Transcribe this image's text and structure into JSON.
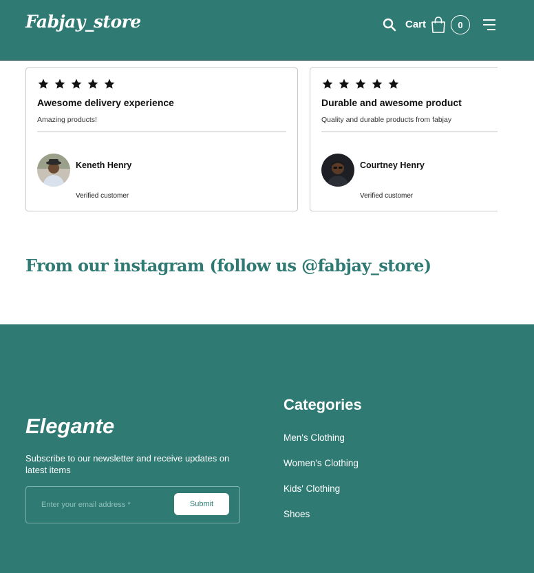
{
  "header": {
    "logo": "Fabjay_store",
    "cart_label": "Cart",
    "cart_count": "0"
  },
  "reviews": [
    {
      "rating": 5,
      "title": "Awesome delivery experience",
      "body": "Amazing products!",
      "name": "Keneth Henry",
      "status": "Verified customer"
    },
    {
      "rating": 5,
      "title": "Durable and awesome product",
      "body": "Quality and durable products from fabjay",
      "name": "Courtney Henry",
      "status": "Verified customer"
    }
  ],
  "instagram": {
    "heading": "From our instagram (follow us @fabjay_store)"
  },
  "footer": {
    "logo": "Elegante",
    "newsletter_text": "Subscribe to our newsletter and receive updates on latest items",
    "email_placeholder": "Enter your email address *",
    "submit_label": "Submit",
    "categories_heading": "Categories",
    "categories": [
      "Men's Clothing",
      "Women's Clothing",
      "Kids' Clothing",
      "Shoes"
    ]
  },
  "colors": {
    "brand": "#2f7a73",
    "text": "#111111",
    "border": "#c9c9c9"
  },
  "icons": {
    "search": "search-icon",
    "cart": "shopping-bag-icon",
    "menu": "menu-icon",
    "star": "star-icon"
  }
}
